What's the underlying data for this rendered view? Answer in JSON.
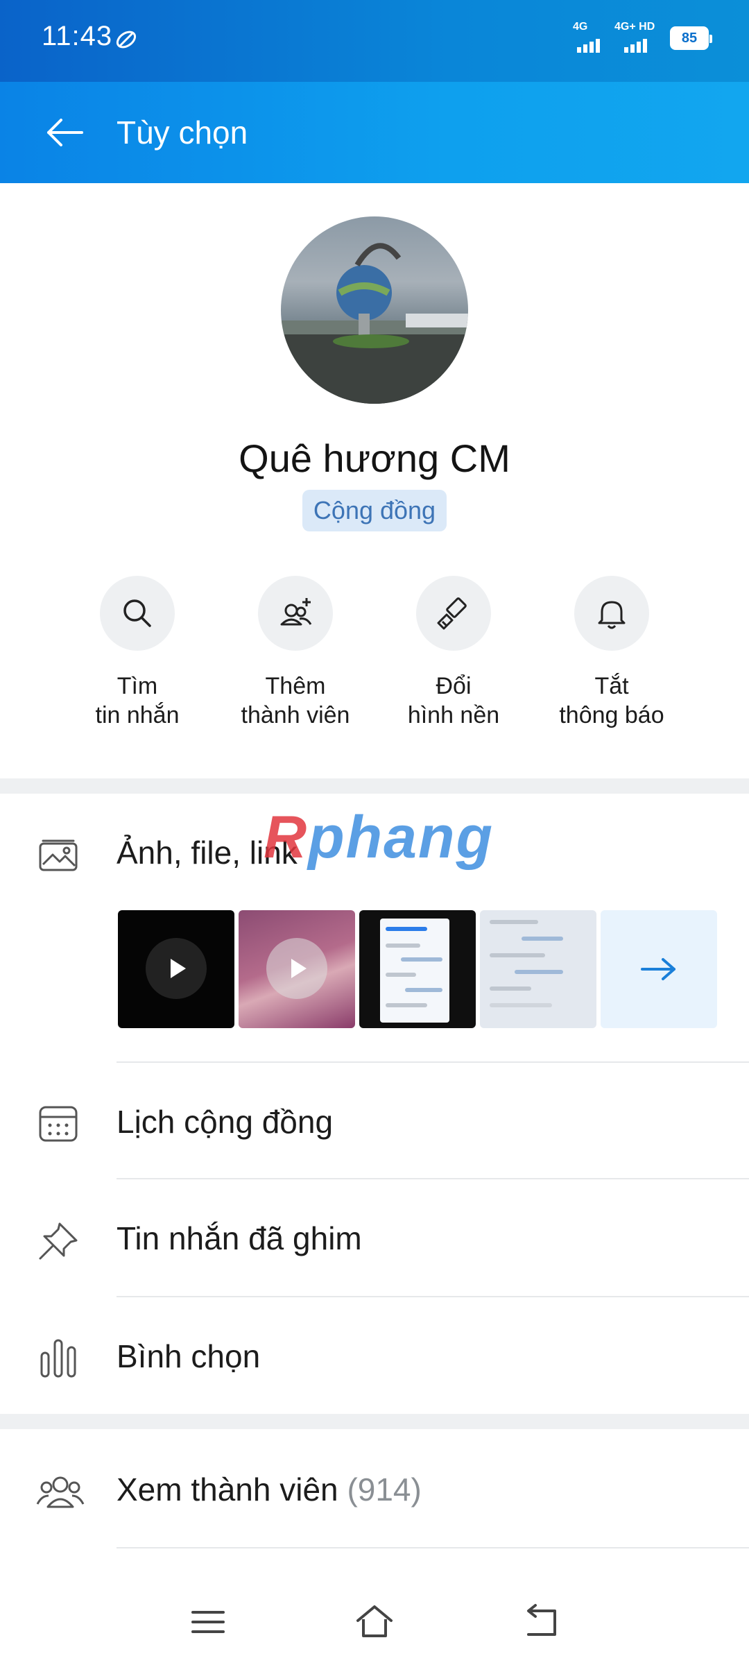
{
  "status_bar": {
    "time": "11:43",
    "network_1": "4G",
    "network_2": "4G+ HD",
    "battery": "85"
  },
  "app_bar": {
    "title": "Tùy chọn"
  },
  "profile": {
    "name": "Quê hương CM",
    "badge": "Cộng đồng"
  },
  "actions": [
    {
      "line1": "Tìm",
      "line2": "tin nhắn",
      "icon": "search-icon"
    },
    {
      "line1": "Thêm",
      "line2": "thành viên",
      "icon": "add-member-icon"
    },
    {
      "line1": "Đổi",
      "line2": "hình nền",
      "icon": "paint-brush-icon"
    },
    {
      "line1": "Tắt",
      "line2": "thông báo",
      "icon": "bell-icon"
    }
  ],
  "menu": {
    "media_label": "Ảnh, file, link",
    "calendar_label": "Lịch cộng đồng",
    "pinned_label": "Tin nhắn đã ghim",
    "poll_label": "Bình chọn",
    "members_label": "Xem thành viên",
    "members_count": "(914)"
  },
  "watermark": {
    "first": "R",
    "rest": "phang"
  },
  "colors": {
    "accent": "#0a83e6",
    "badge_bg": "#dbe9f8",
    "badge_text": "#3d74b6"
  }
}
